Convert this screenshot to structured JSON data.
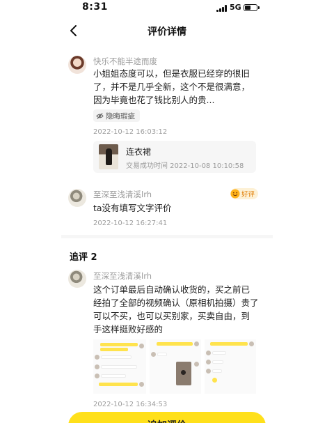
{
  "status_bar": {
    "time": "8:31",
    "network": "5G",
    "battery_level": 0.55,
    "signal_bars": 4
  },
  "header": {
    "title": "评价详情",
    "back_icon": "chevron-left-icon"
  },
  "review": {
    "username": "快乐不能半途而废",
    "text_lines": [
      "小姐姐态度可以，但是衣服已经穿的很旧",
      "了，并不是几乎全新，这个不是很满意，",
      "因为毕竟也花了钱比别人的贵..."
    ],
    "tag": {
      "label": "隐晦瑕疵",
      "icon": "eye-off-icon"
    },
    "timestamp": "2022-10-12 16:03:12",
    "order": {
      "item_name": "连衣裙",
      "status_text": "交易成功时间  2022-10-08 10:10:58"
    }
  },
  "reply": {
    "username": "至深至浅清溪lrh",
    "rating": {
      "label": "好评",
      "icon": "smile-face-icon",
      "color": "#e07a00"
    },
    "text": "ta没有填写文字评价",
    "timestamp": "2022-10-12 16:27:41"
  },
  "followups": {
    "heading": "追评 2",
    "items": [
      {
        "username": "至深至浅清溪lrh",
        "text_lines": [
          "这个订单最后自动确认收货的，买之前已",
          "经拍了全部的视频确认（原相机拍摄）贵了",
          "可以不买，也可以买别家，买卖自由，到",
          "手这样挺败好感的"
        ],
        "images": [
          "chat-screenshot-1",
          "chat-screenshot-2",
          "chat-screenshot-3"
        ],
        "timestamp": "2022-10-12 16:34:53"
      }
    ]
  },
  "bottom_action": {
    "label": "追加评价"
  },
  "colors": {
    "accent_yellow": "#ffe01b",
    "muted_text": "#9a9a9a",
    "rating_orange": "#e07a00"
  }
}
